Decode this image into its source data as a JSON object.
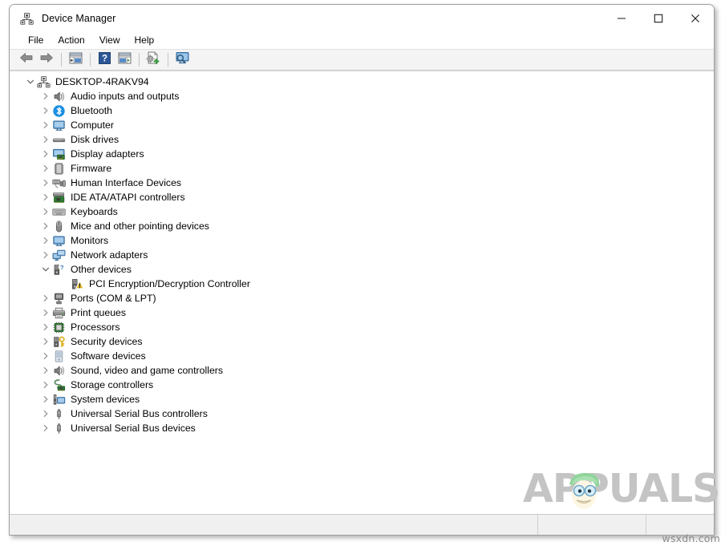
{
  "window": {
    "title": "Device Manager",
    "icon": "device-manager-icon",
    "controls": {
      "minimize": "—",
      "maximize": "☐",
      "close": "✕",
      "minimize_name": "minimize-button",
      "maximize_name": "maximize-button",
      "close_name": "close-button"
    }
  },
  "menubar": {
    "items": [
      {
        "label": "File",
        "name": "menu-file"
      },
      {
        "label": "Action",
        "name": "menu-action"
      },
      {
        "label": "View",
        "name": "menu-view"
      },
      {
        "label": "Help",
        "name": "menu-help"
      }
    ]
  },
  "toolbar": {
    "buttons": [
      {
        "name": "back-button",
        "icon": "arrow-left-icon"
      },
      {
        "name": "forward-button",
        "icon": "arrow-right-icon"
      },
      {
        "name": "show-hide-console-tree-button",
        "icon": "console-tree-icon"
      },
      {
        "name": "help-button",
        "icon": "question-mark-icon"
      },
      {
        "name": "properties-button",
        "icon": "properties-panel-icon"
      },
      {
        "name": "update-driver-button",
        "icon": "update-driver-icon"
      },
      {
        "name": "scan-hardware-changes-button",
        "icon": "scan-monitor-icon"
      }
    ]
  },
  "tree": {
    "root": {
      "label": "DESKTOP-4RAKV94",
      "icon": "computer-root-icon",
      "expanded": true,
      "name": "tree-root-node"
    },
    "nodes": [
      {
        "label": "Audio inputs and outputs",
        "icon": "speaker-icon",
        "expanded": false,
        "depth": 1,
        "name": "tree-node-audio-inputs-and-outputs"
      },
      {
        "label": "Bluetooth",
        "icon": "bluetooth-icon",
        "expanded": false,
        "depth": 1,
        "name": "tree-node-bluetooth"
      },
      {
        "label": "Computer",
        "icon": "monitor-icon",
        "expanded": false,
        "depth": 1,
        "name": "tree-node-computer"
      },
      {
        "label": "Disk drives",
        "icon": "disk-drive-icon",
        "expanded": false,
        "depth": 1,
        "name": "tree-node-disk-drives"
      },
      {
        "label": "Display adapters",
        "icon": "display-adapter-icon",
        "expanded": false,
        "depth": 1,
        "name": "tree-node-display-adapters"
      },
      {
        "label": "Firmware",
        "icon": "firmware-chip-icon",
        "expanded": false,
        "depth": 1,
        "name": "tree-node-firmware"
      },
      {
        "label": "Human Interface Devices",
        "icon": "hid-icon",
        "expanded": false,
        "depth": 1,
        "name": "tree-node-human-interface-devices"
      },
      {
        "label": "IDE ATA/ATAPI controllers",
        "icon": "ide-controller-icon",
        "expanded": false,
        "depth": 1,
        "name": "tree-node-ide-ata-atapi-controllers"
      },
      {
        "label": "Keyboards",
        "icon": "keyboard-icon",
        "expanded": false,
        "depth": 1,
        "name": "tree-node-keyboards"
      },
      {
        "label": "Mice and other pointing devices",
        "icon": "mouse-icon",
        "expanded": false,
        "depth": 1,
        "name": "tree-node-mice-and-other-pointing-devices"
      },
      {
        "label": "Monitors",
        "icon": "monitor-icon",
        "expanded": false,
        "depth": 1,
        "name": "tree-node-monitors"
      },
      {
        "label": "Network adapters",
        "icon": "network-adapter-icon",
        "expanded": false,
        "depth": 1,
        "name": "tree-node-network-adapters"
      },
      {
        "label": "Other devices",
        "icon": "other-device-icon",
        "expanded": true,
        "depth": 1,
        "name": "tree-node-other-devices"
      },
      {
        "label": "PCI Encryption/Decryption Controller",
        "icon": "unknown-device-warning-icon",
        "expanded": null,
        "depth": 2,
        "name": "tree-node-pci-encryption-decryption-controller"
      },
      {
        "label": "Ports (COM & LPT)",
        "icon": "port-icon",
        "expanded": false,
        "depth": 1,
        "name": "tree-node-ports-com-and-lpt"
      },
      {
        "label": "Print queues",
        "icon": "printer-icon",
        "expanded": false,
        "depth": 1,
        "name": "tree-node-print-queues"
      },
      {
        "label": "Processors",
        "icon": "processor-icon",
        "expanded": false,
        "depth": 1,
        "name": "tree-node-processors"
      },
      {
        "label": "Security devices",
        "icon": "security-key-icon",
        "expanded": false,
        "depth": 1,
        "name": "tree-node-security-devices"
      },
      {
        "label": "Software devices",
        "icon": "software-device-icon",
        "expanded": false,
        "depth": 1,
        "name": "tree-node-software-devices"
      },
      {
        "label": "Sound, video and game controllers",
        "icon": "speaker-icon",
        "expanded": false,
        "depth": 1,
        "name": "tree-node-sound-video-and-game-controllers"
      },
      {
        "label": "Storage controllers",
        "icon": "storage-controller-icon",
        "expanded": false,
        "depth": 1,
        "name": "tree-node-storage-controllers"
      },
      {
        "label": "System devices",
        "icon": "system-device-icon",
        "expanded": false,
        "depth": 1,
        "name": "tree-node-system-devices"
      },
      {
        "label": "Universal Serial Bus controllers",
        "icon": "usb-icon",
        "expanded": false,
        "depth": 1,
        "name": "tree-node-universal-serial-bus-controllers"
      },
      {
        "label": "Universal Serial Bus devices",
        "icon": "usb-icon",
        "expanded": false,
        "depth": 1,
        "name": "tree-node-universal-serial-bus-devices"
      }
    ]
  },
  "statusbar": {
    "cells": [
      "",
      "",
      ""
    ]
  },
  "watermark": {
    "text": "APPUALS",
    "face_icon": "appuals-mascot-icon"
  },
  "site_tag": "wsxdn.com",
  "colors": {
    "accent_blue": "#0078d7",
    "bluetooth_blue": "#1a8fe3",
    "warning_yellow": "#f2c12e",
    "window_border": "#9e9e9e",
    "toolbar_bg": "#f4f4f4",
    "statusbar_bg": "#f0f0f0",
    "watermark_gray": "#c4c4c4",
    "mascot_green": "#8fd49a"
  }
}
